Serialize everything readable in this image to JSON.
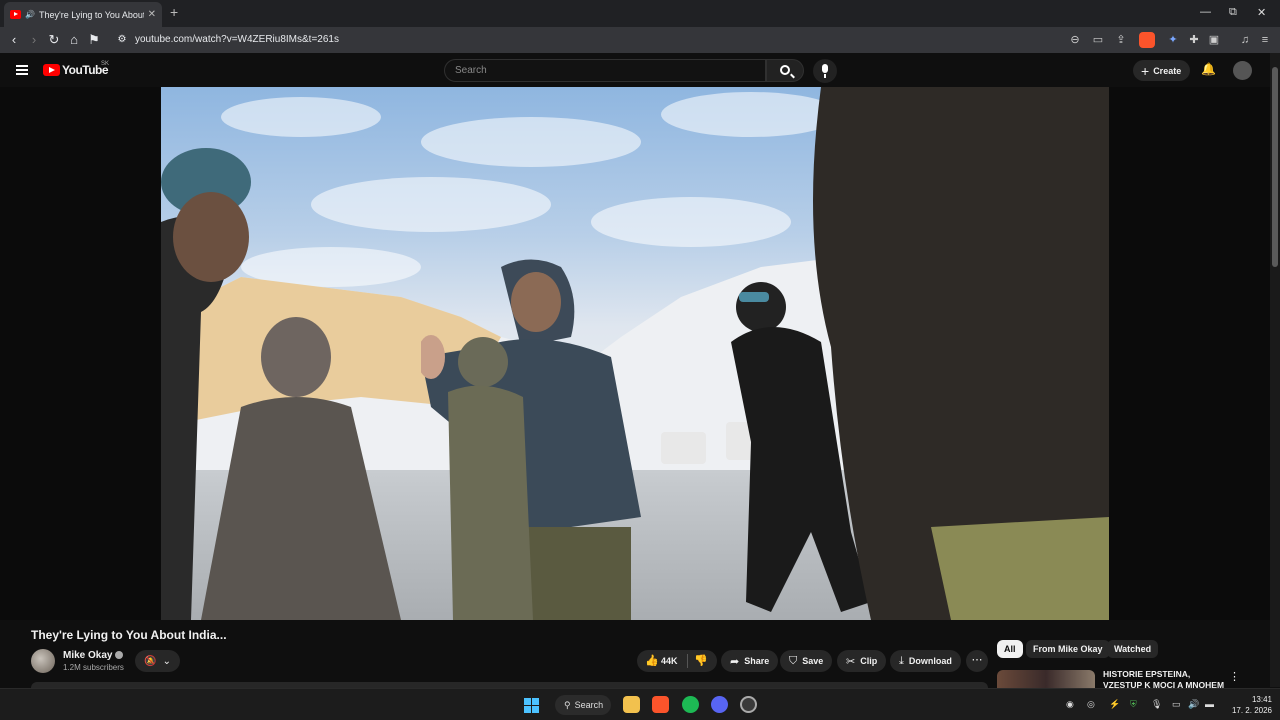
{
  "browser": {
    "tab_title": "They're Lying to You About India...",
    "tab_audio_icon": "speaker-icon",
    "url": "youtube.com/watch?v=W4ZERiu8IMs&t=261s",
    "new_tab_label": "+",
    "win_minimize": "—",
    "win_restore": "⧉",
    "win_close": "✕"
  },
  "youtube": {
    "logo_text": "YouTube",
    "region": "SK",
    "search_placeholder": "Search",
    "create_label": "Create"
  },
  "video": {
    "title": "They're Lying to You About India...",
    "channel": "Mike Okay",
    "subscribers": "1.2M subscribers",
    "likes": "44K",
    "share_label": "Share",
    "save_label": "Save",
    "clip_label": "Clip",
    "download_label": "Download"
  },
  "filters": {
    "all": "All",
    "from_channel": "From Mike Okay",
    "watched": "Watched"
  },
  "recommendation": {
    "title": "HISTORIE EPSTEINA, VZESTUP K MOCI A MNOHEM VÍC"
  },
  "taskbar": {
    "search_label": "Search",
    "time": "13:41",
    "date": "17. 2. 2026"
  },
  "colors": {
    "youtube_red": "#ff0000",
    "background": "#0f0f0f",
    "button_bg": "#272727"
  }
}
